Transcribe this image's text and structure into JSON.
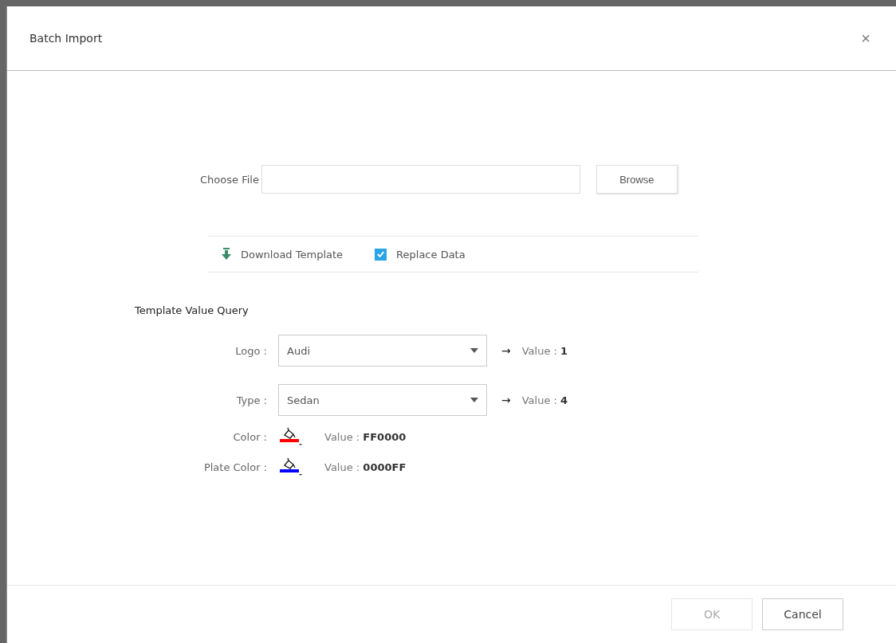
{
  "dialog": {
    "title": "Batch Import",
    "close": "×"
  },
  "file": {
    "label": "Choose File",
    "browse": "Browse"
  },
  "options": {
    "download": "Download Template",
    "replace": {
      "label": "Replace Data",
      "checked": true
    }
  },
  "query": {
    "title": "Template Value Query",
    "selects": [
      {
        "label": "Logo :",
        "value": "Audi",
        "arrow": "→",
        "result": "Value : **1**"
      },
      {
        "label": "Type :",
        "value": "Sedan",
        "arrow": "→",
        "result": "Value : **4**"
      }
    ],
    "colors": [
      {
        "label": "Color :",
        "color": "#ff0000",
        "result": "Value : **FF0000**"
      },
      {
        "label": "Plate Color :",
        "color": "#0000ff",
        "result": "Value : **0000FF**"
      }
    ]
  },
  "buttons": [
    {
      "label": "OK",
      "disabled": true
    },
    {
      "label": "Cancel",
      "disabled": false
    }
  ]
}
